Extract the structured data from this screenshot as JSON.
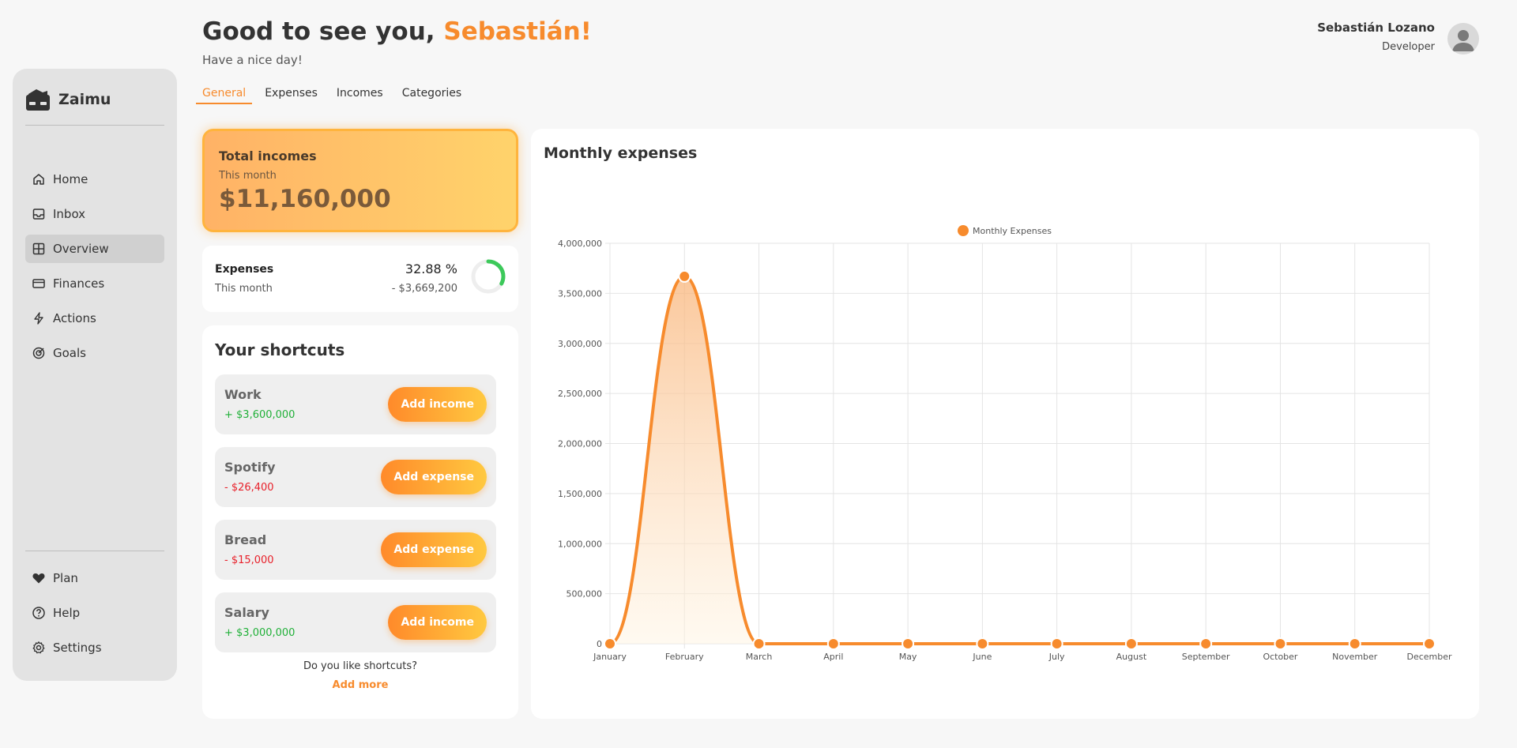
{
  "app": {
    "name": "Zaimu"
  },
  "sidebar": {
    "items": [
      {
        "label": "Home",
        "icon": "home-icon"
      },
      {
        "label": "Inbox",
        "icon": "inbox-icon"
      },
      {
        "label": "Overview",
        "icon": "grid-icon",
        "active": true
      },
      {
        "label": "Finances",
        "icon": "card-icon"
      },
      {
        "label": "Actions",
        "icon": "bolt-icon"
      },
      {
        "label": "Goals",
        "icon": "target-icon"
      }
    ],
    "bottom_items": [
      {
        "label": "Plan",
        "icon": "heart-icon"
      },
      {
        "label": "Help",
        "icon": "help-icon"
      },
      {
        "label": "Settings",
        "icon": "gear-icon"
      }
    ]
  },
  "header": {
    "greeting_prefix": "Good to see you, ",
    "greeting_name": "Sebastián!",
    "subtitle": "Have a nice day!"
  },
  "user": {
    "name": "Sebastián Lozano",
    "role": "Developer"
  },
  "tabs": [
    {
      "label": "General",
      "active": true
    },
    {
      "label": "Expenses"
    },
    {
      "label": "Incomes"
    },
    {
      "label": "Categories"
    }
  ],
  "income_card": {
    "title": "Total incomes",
    "period": "This month",
    "value": "$11,160,000"
  },
  "expenses_card": {
    "title": "Expenses",
    "period": "This month",
    "percent": "32.88 %",
    "value": "- $3,669,200",
    "ratio": 0.3288
  },
  "shortcuts": {
    "title": "Your shortcuts",
    "items": [
      {
        "name": "Work",
        "amount": "+ $3,600,000",
        "type": "pos",
        "button": "Add income"
      },
      {
        "name": "Spotify",
        "amount": "- $26,400",
        "type": "neg",
        "button": "Add expense"
      },
      {
        "name": "Bread",
        "amount": "- $15,000",
        "type": "neg",
        "button": "Add expense"
      },
      {
        "name": "Salary",
        "amount": "+ $3,000,000",
        "type": "pos",
        "button": "Add income"
      }
    ],
    "question": "Do you like shortcuts?",
    "add_more": "Add more"
  },
  "chart_card": {
    "title": "Monthly expenses"
  },
  "colors": {
    "accent": "#f78b2d",
    "positive": "#20b038",
    "negative": "#e8202a"
  },
  "chart_data": {
    "type": "area",
    "title": "Monthly expenses",
    "categories": [
      "January",
      "February",
      "March",
      "April",
      "May",
      "June",
      "July",
      "August",
      "September",
      "October",
      "November",
      "December"
    ],
    "series": [
      {
        "name": "Monthly Expenses",
        "values": [
          0,
          3669200,
          0,
          0,
          0,
          0,
          0,
          0,
          0,
          0,
          0,
          0
        ]
      }
    ],
    "ylim": [
      0,
      4000000
    ],
    "yticks": [
      0,
      500000,
      1000000,
      1500000,
      2000000,
      2500000,
      3000000,
      3500000,
      4000000
    ],
    "ytick_labels": [
      "0",
      "500,000",
      "1,000,000",
      "1,500,000",
      "2,000,000",
      "2,500,000",
      "3,000,000",
      "3,500,000",
      "4,000,000"
    ],
    "legend": "top-center",
    "grid": true,
    "color": "#f78b2d"
  }
}
